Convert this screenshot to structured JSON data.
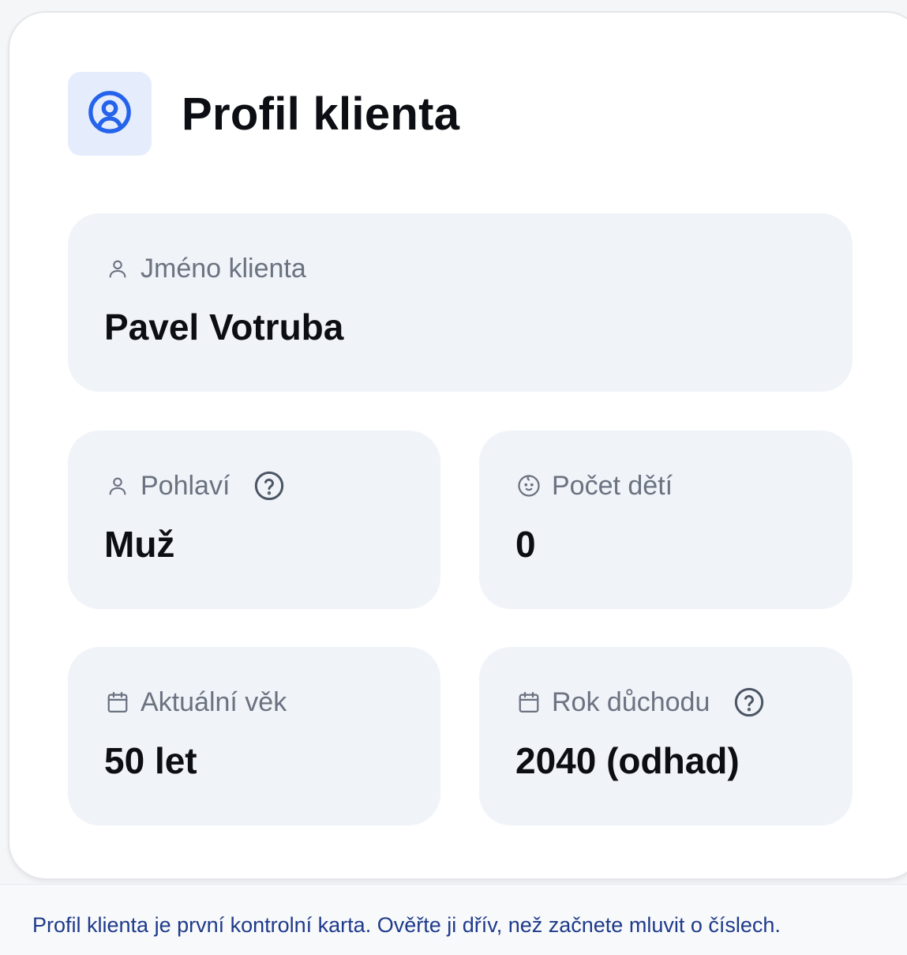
{
  "card": {
    "title": "Profil klienta",
    "header_icon": "user-circle-icon",
    "fields": {
      "name": {
        "label": "Jméno klienta",
        "value": "Pavel Votruba",
        "icon": "user-icon"
      },
      "gender": {
        "label": "Pohlaví",
        "value": "Muž",
        "icon": "user-icon",
        "help_icon": "help-circle-icon"
      },
      "children": {
        "label": "Počet dětí",
        "value": "0",
        "icon": "baby-icon"
      },
      "age": {
        "label": "Aktuální věk",
        "value": "50 let",
        "icon": "calendar-icon"
      },
      "retirement": {
        "label": "Rok důchodu",
        "value": "2040 (odhad)",
        "icon": "calendar-icon",
        "help_icon": "help-circle-icon"
      }
    }
  },
  "footer": {
    "text": "Profil klienta je první kontrolní karta. Ověřte ji dřív, než začnete mluvit o číslech."
  },
  "colors": {
    "accent": "#2563eb",
    "accent_bg": "#e5edfd",
    "field_bg": "#f0f3f8",
    "label": "#6b7280",
    "value": "#0c0e13",
    "footer_text": "#1e3a8a"
  }
}
